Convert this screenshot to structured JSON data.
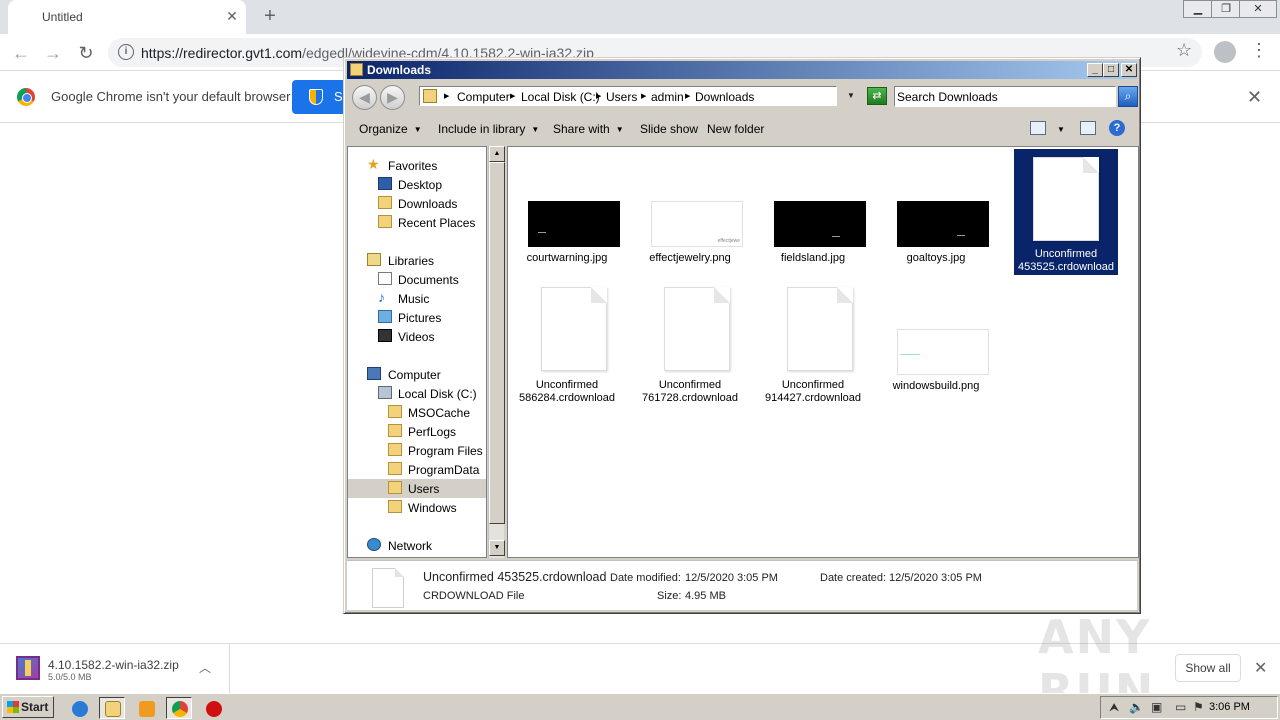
{
  "browser": {
    "tab_title": "Untitled",
    "url_host": "https://redirector.gvt1.com",
    "url_path": "/edgedl/widevine-cdm/4.10.1582.2-win-ia32.zip",
    "infobar_message": "Google Chrome isn't your default browser",
    "infobar_button": "S",
    "download": {
      "filename": "4.10.1582.2-win-ia32.zip",
      "progress": "5.0/5.0 MB"
    },
    "show_all": "Show all"
  },
  "explorer": {
    "title": "Downloads",
    "breadcrumbs": [
      "Computer",
      "Local Disk (C:)",
      "Users",
      "admin",
      "Downloads"
    ],
    "search_placeholder": "Search Downloads",
    "commands": {
      "organize": "Organize",
      "include_in_library": "Include in library",
      "share_with": "Share with",
      "slide_show": "Slide show",
      "new_folder": "New folder"
    },
    "nav": [
      {
        "label": "Favorites",
        "icon": "star-icon"
      },
      {
        "label": "Desktop",
        "icon": "desktop-icon"
      },
      {
        "label": "Downloads",
        "icon": "downloads-folder-icon"
      },
      {
        "label": "Recent Places",
        "icon": "recent-places-icon"
      },
      {
        "label": "Libraries",
        "icon": "libraries-icon"
      },
      {
        "label": "Documents",
        "icon": "documents-icon"
      },
      {
        "label": "Music",
        "icon": "music-icon"
      },
      {
        "label": "Pictures",
        "icon": "pictures-icon"
      },
      {
        "label": "Videos",
        "icon": "videos-icon"
      },
      {
        "label": "Computer",
        "icon": "computer-icon"
      },
      {
        "label": "Local Disk (C:)",
        "icon": "local-disk-icon"
      },
      {
        "label": "MSOCache",
        "icon": "folder-icon"
      },
      {
        "label": "PerfLogs",
        "icon": "folder-icon"
      },
      {
        "label": "Program Files",
        "icon": "folder-icon"
      },
      {
        "label": "ProgramData",
        "icon": "folder-icon"
      },
      {
        "label": "Users",
        "icon": "folder-icon"
      },
      {
        "label": "Windows",
        "icon": "folder-icon"
      },
      {
        "label": "Network",
        "icon": "network-icon"
      }
    ],
    "selected_nav": "Users",
    "files": [
      {
        "name": "courtwarning.jpg",
        "type": "image-thumbnail"
      },
      {
        "name": "effectjewelry.png",
        "type": "image-thumbnail"
      },
      {
        "name": "fieldsland.jpg",
        "type": "image-thumbnail"
      },
      {
        "name": "goaltoys.jpg",
        "type": "image-thumbnail"
      },
      {
        "name_line1": "Unconfirmed",
        "name_line2": "453525.crdownload",
        "type": "document",
        "selected": true
      },
      {
        "name_line1": "Unconfirmed",
        "name_line2": "586284.crdownload",
        "type": "document"
      },
      {
        "name_line1": "Unconfirmed",
        "name_line2": "761728.crdownload",
        "type": "document"
      },
      {
        "name_line1": "Unconfirmed",
        "name_line2": "914427.crdownload",
        "type": "document"
      },
      {
        "name": "windowsbuild.png",
        "type": "image-thumbnail"
      }
    ],
    "thumbnail_text": "effectjewe",
    "details": {
      "name": "Unconfirmed 453525.crdownload",
      "type": "CRDOWNLOAD File",
      "date_modified_label": "Date modified:",
      "date_modified": "12/5/2020 3:05 PM",
      "date_created_label": "Date created:",
      "date_created": "12/5/2020 3:05 PM",
      "size_label": "Size:",
      "size": "4.95 MB"
    }
  },
  "taskbar": {
    "start": "Start",
    "clock": "3:06 PM"
  },
  "watermark": "ANY RUN",
  "colors": {
    "titlebar_start": "#0a246a",
    "titlebar_end": "#a6caf0",
    "selection": "#0a246a",
    "chrome_blue": "#1a73e8"
  }
}
